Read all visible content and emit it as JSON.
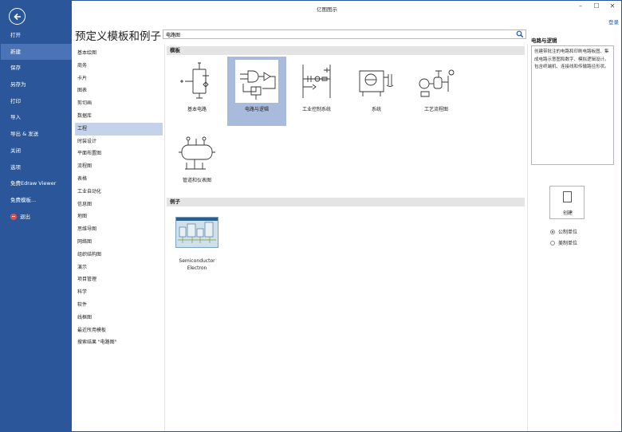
{
  "window": {
    "title": "亿图图示"
  },
  "titlebar": {
    "minimize": "–",
    "maximize": "☐",
    "close": "✕"
  },
  "header": {
    "login": "登录",
    "heading": "预定义模板和例子"
  },
  "search": {
    "value": "电路图",
    "placeholder": ""
  },
  "sidebar": {
    "items": [
      {
        "label": "打开"
      },
      {
        "label": "新建"
      },
      {
        "label": "保存"
      },
      {
        "label": "另存为"
      },
      {
        "label": "打印"
      },
      {
        "label": "导入"
      },
      {
        "label": "导出 & 发送"
      },
      {
        "label": "关闭"
      },
      {
        "label": "选项"
      },
      {
        "label": "免费Edraw Viewer"
      },
      {
        "label": "免费模板..."
      },
      {
        "label": "退出"
      }
    ],
    "active_index": 1
  },
  "categories": {
    "items": [
      "基本绘图",
      "商务",
      "卡片",
      "图表",
      "剪切画",
      "数据库",
      "工程",
      "时装设计",
      "平面布置图",
      "流程图",
      "表格",
      "工业自动化",
      "信息图",
      "地图",
      "思维导图",
      "网络图",
      "组织结构图",
      "演示",
      "项目管理",
      "科学",
      "软件",
      "线框图",
      "最近所用模板",
      "搜索结果 \"电路图\""
    ],
    "active_index": 6
  },
  "templates": {
    "section_label": "模板",
    "items": [
      {
        "label": "基本电路"
      },
      {
        "label": "电路与逻辑"
      },
      {
        "label": "工业控制系统"
      },
      {
        "label": "系统"
      },
      {
        "label": "工艺流程图"
      },
      {
        "label": "管道和仪表图"
      }
    ],
    "selected_index": 1
  },
  "examples": {
    "section_label": "例子",
    "items": [
      {
        "label_line1": "Semiconductor",
        "label_line2": "Electron"
      }
    ]
  },
  "details": {
    "title": "电路与逻辑",
    "description": "创建带批注的电路和印刷电路板图、集成电路示意图和数字、模拟逻辑设计。包含终端机、连接线和传输路径形状。",
    "create_label": "创建",
    "units": [
      {
        "label": "公制单位",
        "checked": true
      },
      {
        "label": "美制单位",
        "checked": false
      }
    ]
  },
  "colors": {
    "sidebar": "#2b579a",
    "sidebar_active": "#4a74b6",
    "selection": "#a9bbdc",
    "link": "#1a56c8"
  }
}
